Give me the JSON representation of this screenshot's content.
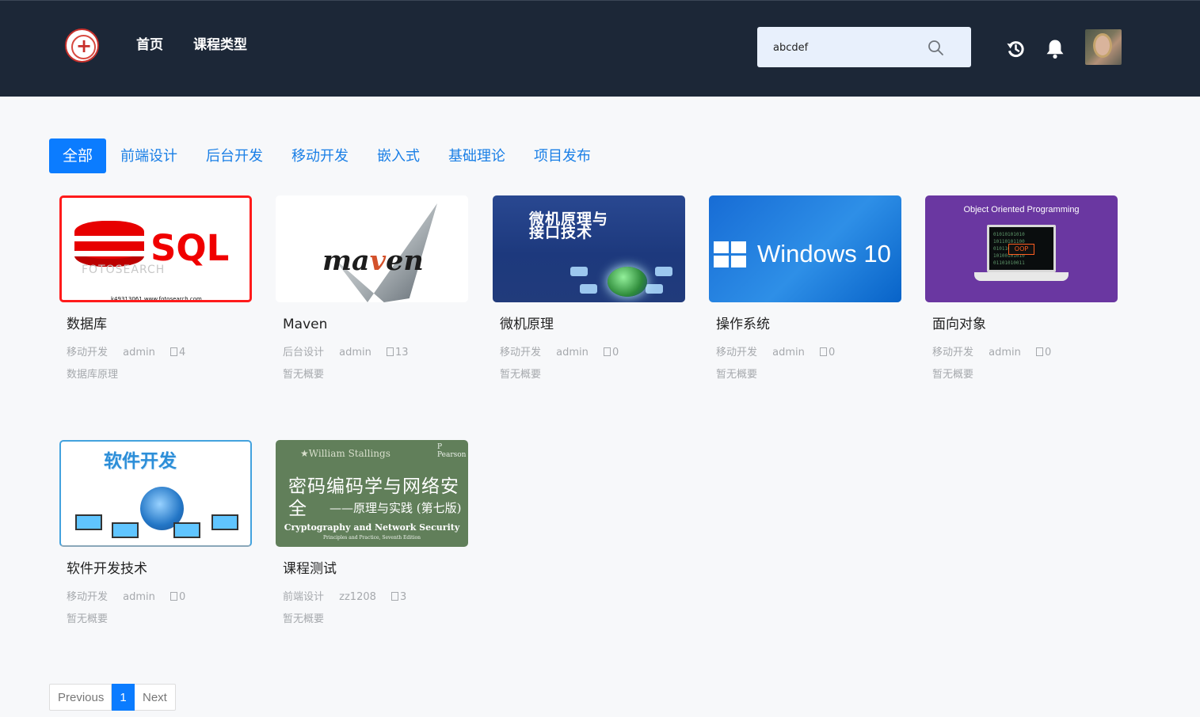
{
  "header": {
    "nav": {
      "home": "首页",
      "course_types": "课程类型"
    },
    "search": {
      "value": "abcdef"
    },
    "icons": {
      "search": "search-icon",
      "history": "history-icon",
      "notifications": "bell-icon",
      "avatar": "user-avatar"
    }
  },
  "filters": [
    "全部",
    "前端设计",
    "后台开发",
    "移动开发",
    "嵌入式",
    "基础理论",
    "项目发布"
  ],
  "courses": [
    {
      "title": "数据库",
      "category": "移动开发",
      "author": "admin",
      "count": "4",
      "summary": "数据库原理",
      "cover": {
        "text": "SQL",
        "watermark": "FOTOSEARCH",
        "footer": "k49313061 www.fotosearch.com"
      }
    },
    {
      "title": "Maven",
      "category": "后台设计",
      "author": "admin",
      "count": "13",
      "summary": "暂无概要",
      "cover": {
        "text_start": "ma",
        "text_mid": "v",
        "text_end": "en"
      }
    },
    {
      "title": "微机原理",
      "category": "移动开发",
      "author": "admin",
      "count": "0",
      "summary": "暂无概要",
      "cover": {
        "line1": "微机原理与",
        "line2": "接口技术"
      }
    },
    {
      "title": "操作系统",
      "category": "移动开发",
      "author": "admin",
      "count": "0",
      "summary": "暂无概要",
      "cover": {
        "text": "Windows 10"
      }
    },
    {
      "title": "面向对象",
      "category": "移动开发",
      "author": "admin",
      "count": "0",
      "summary": "暂无概要",
      "cover": {
        "text": "Object Oriented Programming",
        "chip": "OOP"
      }
    },
    {
      "title": "软件开发技术",
      "category": "移动开发",
      "author": "admin",
      "count": "0",
      "summary": "暂无概要",
      "cover": {
        "text": "软件开发"
      }
    },
    {
      "title": "课程测试",
      "category": "前端设计",
      "author": "zz1208",
      "count": "3",
      "summary": "暂无概要",
      "cover": {
        "author": "★William Stallings",
        "badge": "P Pearson",
        "title": "密码编码学与网络安全",
        "subtitle": "——原理与实践 (第七版)",
        "english": "Cryptography and Network Security",
        "small": "Principles and Practice, Seventh Edition"
      }
    }
  ],
  "pagination": {
    "previous": "Previous",
    "current": "1",
    "next": "Next"
  },
  "colors": {
    "header_bg": "#1c2737",
    "accent": "#0b7cff",
    "page_bg": "#f7f8fa"
  }
}
